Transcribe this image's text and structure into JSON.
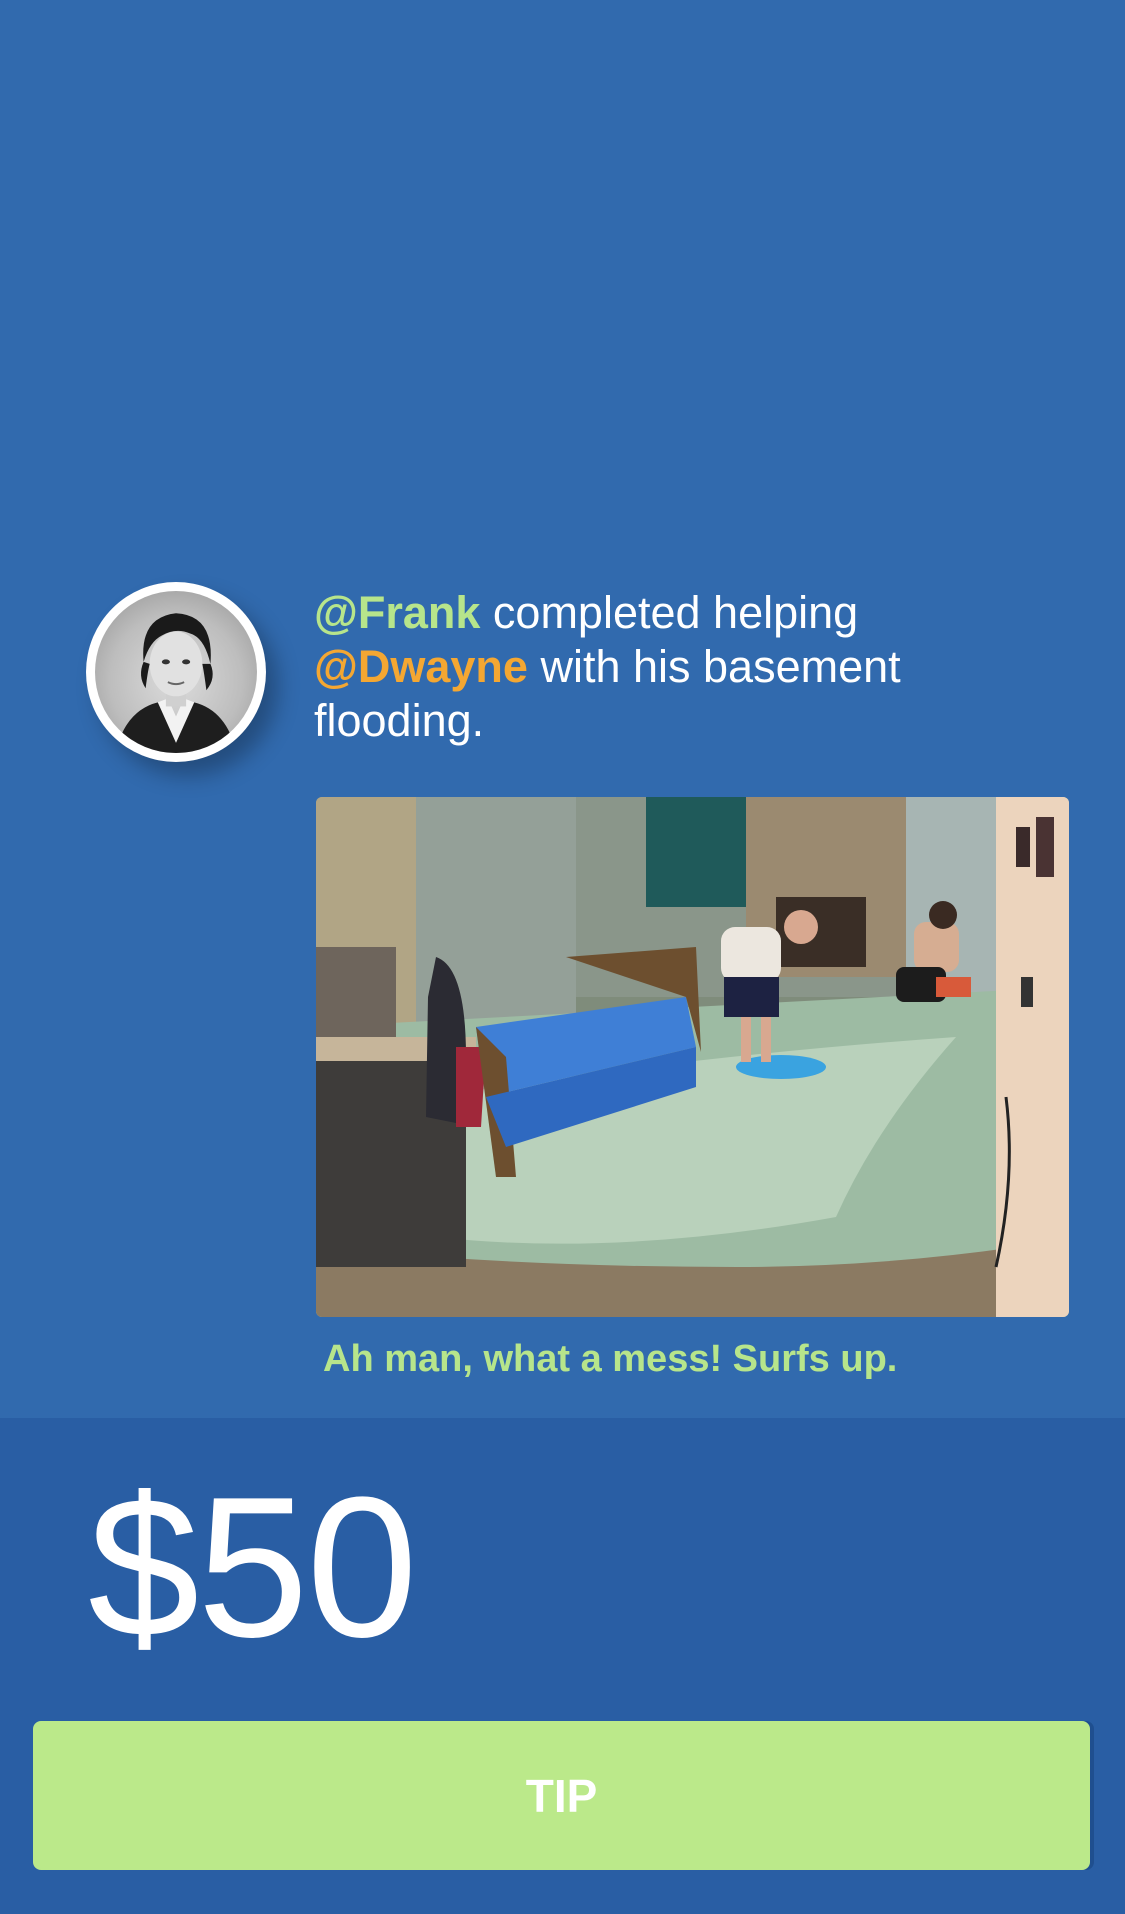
{
  "activity": {
    "actor": "@Frank",
    "text_1": " completed helping ",
    "recipient": "@Dwayne",
    "text_2": " with his basement flooding."
  },
  "caption": "Ah man, what a mess! Surfs up.",
  "amount": "$50",
  "tip_button": {
    "label": "TIP"
  },
  "colors": {
    "background": "#316aae",
    "panel": "#295ea4",
    "accent_green": "#b7e58b",
    "accent_orange": "#f4a732",
    "button": "#bbe98a"
  },
  "icons": {
    "avatar": "user-avatar-photo",
    "photo": "flooded-basement-photo"
  }
}
